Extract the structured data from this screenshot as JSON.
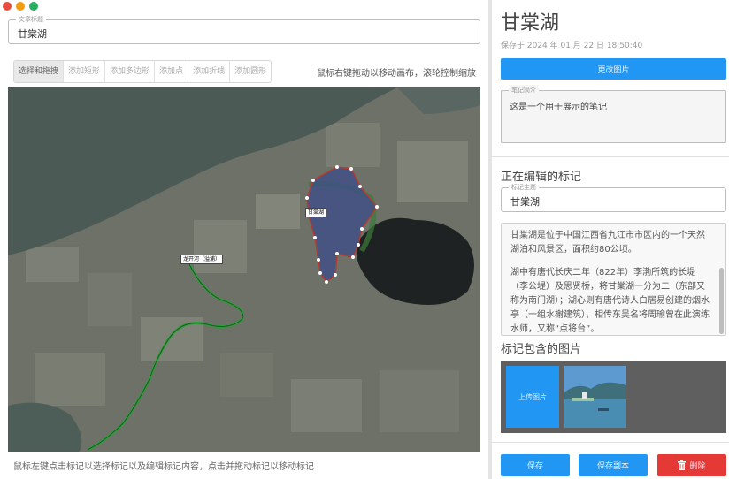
{
  "window": {
    "controls": [
      "close",
      "minimize",
      "maximize"
    ]
  },
  "article_title": {
    "legend": "文章标题",
    "value": "甘棠湖"
  },
  "toolbar": {
    "tools": [
      "选择和拖拽",
      "添加矩形",
      "添加多边形",
      "添加点",
      "添加折线",
      "添加圆形"
    ],
    "active_index": 0,
    "hint": "鼠标右键拖动以移动画布，滚轮控制缩放"
  },
  "map": {
    "labels": {
      "lake": "甘棠湖",
      "river": "龙开河（溢浦）"
    },
    "footer_hint": "鼠标左键点击标记以选择标记以及编辑标记内容，点击并拖动标记以移动标记"
  },
  "sidebar": {
    "title": "甘棠湖",
    "saved_at": "保存于 2024 年 01 月 22 日 18:50:40",
    "change_image_btn": "更改图片",
    "note_summary": {
      "legend": "笔记简介",
      "value": "这是一个用于展示的笔记"
    },
    "editing_section_title": "正在编辑的标记",
    "marker_title": {
      "legend": "标记主题",
      "value": "甘棠湖"
    },
    "description": [
      "甘棠湖是位于中国江西省九江市市区内的一个天然湖泊和风景区，面积约80公顷。",
      "湖中有唐代长庆二年（822年）李渤所筑的长堤（李公堤）及思贤桥，将甘棠湖一分为二（东部又称为南门湖）；湖心则有唐代诗人白居易创建的烟水亭（一组水榭建筑），相传东吴名将周瑜曾在此演练水师，又称“点将台”。"
    ],
    "images_section_title": "标记包含的图片",
    "upload_btn": "上传图片",
    "buttons": {
      "save": "保存",
      "save_copy": "保存副本",
      "delete": "删除"
    }
  },
  "colors": {
    "accent": "#2196f3",
    "danger": "#e53935",
    "polygon_fill": "#3f4f86",
    "polyline": "#2e9e3a"
  }
}
